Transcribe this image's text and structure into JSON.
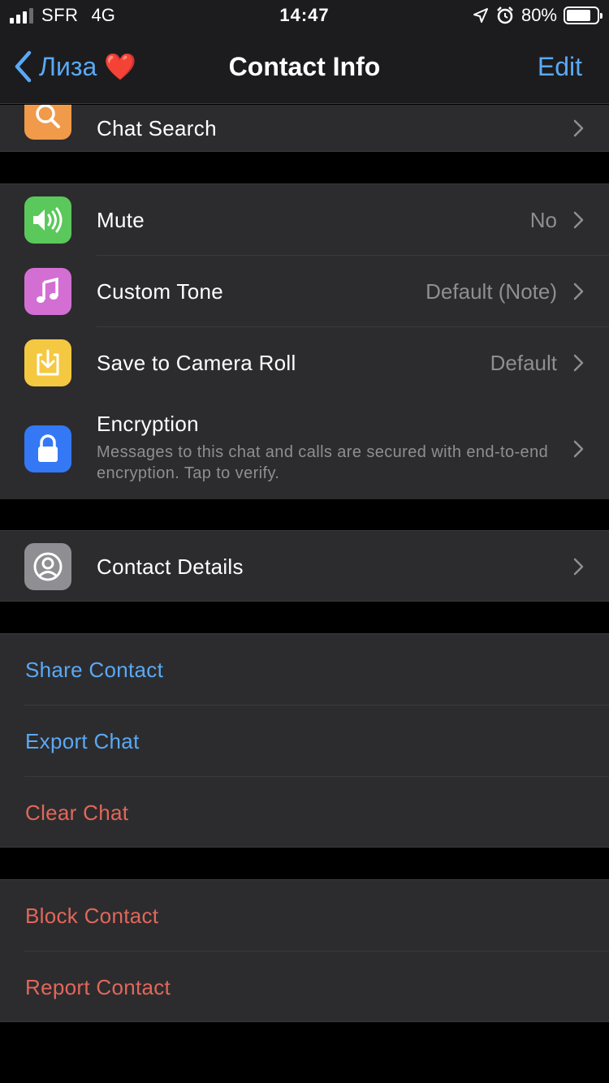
{
  "status_bar": {
    "carrier": "SFR",
    "network": "4G",
    "time": "14:47",
    "battery": "80%",
    "battery_level": 0.8,
    "icons": [
      "location-icon",
      "alarm-icon"
    ]
  },
  "nav": {
    "back_label": "Лиза ❤️",
    "title": "Contact Info",
    "edit_label": "Edit"
  },
  "top_group": {
    "chat_search": "Chat Search"
  },
  "settings_group": {
    "mute": {
      "label": "Mute",
      "value": "No"
    },
    "custom_tone": {
      "label": "Custom Tone",
      "value": "Default (Note)"
    },
    "save_camera": {
      "label": "Save to Camera Roll",
      "value": "Default"
    },
    "encryption": {
      "label": "Encryption",
      "description": "Messages to this chat and calls are secured with end-to-end encryption. Tap to verify."
    }
  },
  "details_group": {
    "contact_details": "Contact Details"
  },
  "actions_group": {
    "share": "Share Contact",
    "export": "Export Chat",
    "clear": "Clear Chat"
  },
  "danger_group": {
    "block": "Block Contact",
    "report": "Report Contact"
  },
  "colors": {
    "accent": "#5aa9f5",
    "destructive": "#e2675a",
    "search_icon_bg": "#f09a4a",
    "mute_icon_bg": "#5ac85a",
    "tone_icon_bg": "#d36fd2",
    "save_icon_bg": "#f5c842",
    "lock_icon_bg": "#3478f6",
    "contact_icon_bg": "#8e8e93"
  }
}
